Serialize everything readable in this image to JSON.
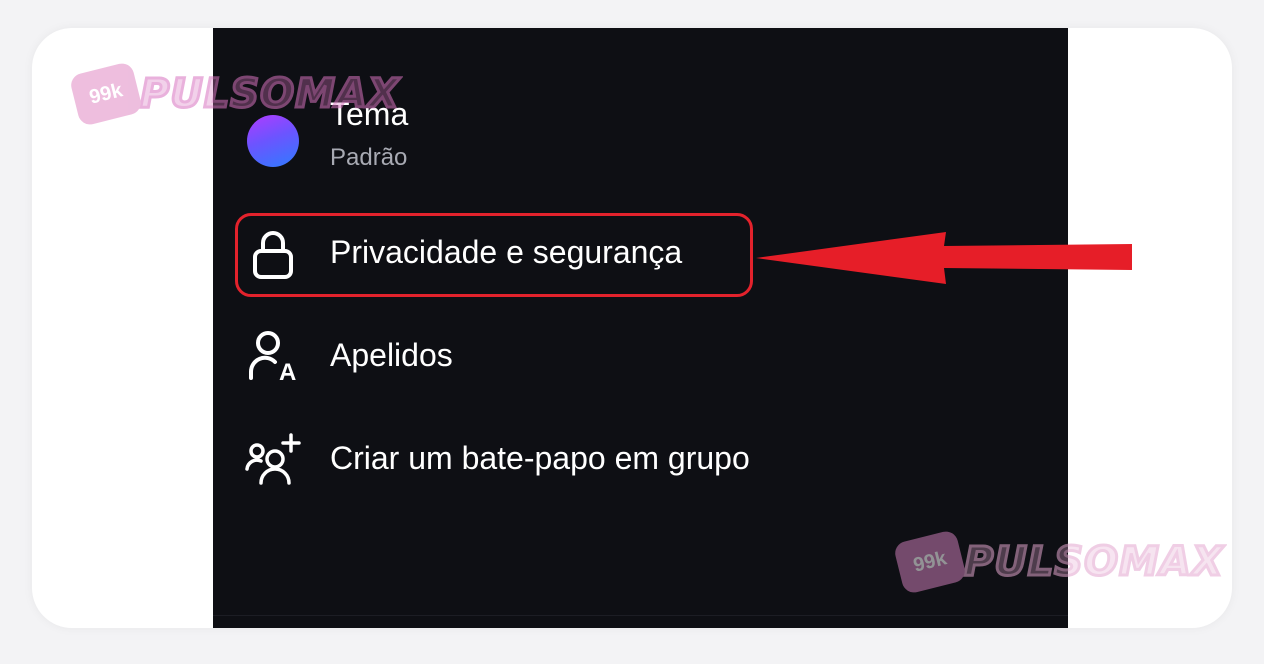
{
  "menu": {
    "items": [
      {
        "id": "theme",
        "title": "Tema",
        "subtitle": "Padrão",
        "icon": "theme-circle-icon"
      },
      {
        "id": "privacy",
        "title": "Privacidade e segurança",
        "icon": "lock-icon"
      },
      {
        "id": "nicknames",
        "title": "Apelidos",
        "icon": "person-letter-a-icon"
      },
      {
        "id": "group",
        "title": "Criar um bate-papo em grupo",
        "icon": "add-group-icon"
      }
    ]
  },
  "annotation": {
    "highlight_color": "#e3222c",
    "arrow_color": "#e61e28",
    "points_to": "privacy"
  },
  "watermarks": [
    {
      "badge": "99k",
      "text": "PULSOMAX"
    },
    {
      "badge": "99k",
      "text": "PULSOMAX"
    }
  ],
  "colors": {
    "background": "#0e0f14",
    "text_primary": "#ffffff",
    "text_secondary": "#a8aab3"
  }
}
